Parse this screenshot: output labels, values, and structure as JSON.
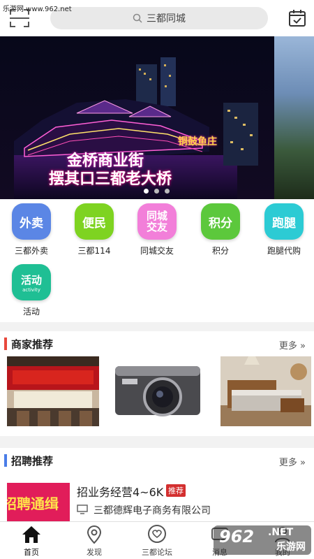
{
  "watermark_top": "乐游网 www.962.net",
  "header": {
    "search_text": "三都同城"
  },
  "banner": {
    "caption_line1": "金桥商业街",
    "caption_line2": "摆其口三都老大桥",
    "neon_text": "铜鼓鱼庄",
    "page_count": 3,
    "active_index": 0
  },
  "quick_links": [
    {
      "icon_text": "外卖",
      "label": "三都外卖",
      "color": "#5b86e5"
    },
    {
      "icon_text": "便民",
      "label": "三都114",
      "color": "#7ed321"
    },
    {
      "icon_text": "同城\n交友",
      "label": "同城交友",
      "color": "#f27fd9"
    },
    {
      "icon_text": "积分",
      "label": "积分",
      "color": "#5cc83c"
    },
    {
      "icon_text": "跑腿",
      "label": "跑腿代购",
      "color": "#2ccbd4"
    },
    {
      "icon_text": "活动",
      "icon_sub": "activity",
      "label": "活动",
      "color": "#1fbf94"
    }
  ],
  "merchant_section": {
    "title": "商家推荐",
    "more": "更多",
    "accent": "#e8483c",
    "items": [
      "restaurant-storefront",
      "digital-camera",
      "bedroom-furniture"
    ]
  },
  "jobs_section": {
    "title": "招聘推荐",
    "more": "更多",
    "accent": "#4a7de8",
    "job_title": "招业务经营4~6K",
    "job_tag": "推荐",
    "company": "三都德辉电子商务有限公司",
    "image_text": "招聘通缉"
  },
  "tabbar": {
    "tabs": [
      {
        "label": "首页",
        "icon": "home-icon"
      },
      {
        "label": "发现",
        "icon": "location-pin-icon"
      },
      {
        "label": "三都论坛",
        "icon": "heart-chat-icon"
      },
      {
        "label": "消息",
        "icon": "message-icon"
      },
      {
        "label": "我的",
        "icon": "user-icon"
      }
    ]
  },
  "watermark_bottom": {
    "main": "962",
    "sub": "乐游网",
    "suffix": ".NET"
  }
}
